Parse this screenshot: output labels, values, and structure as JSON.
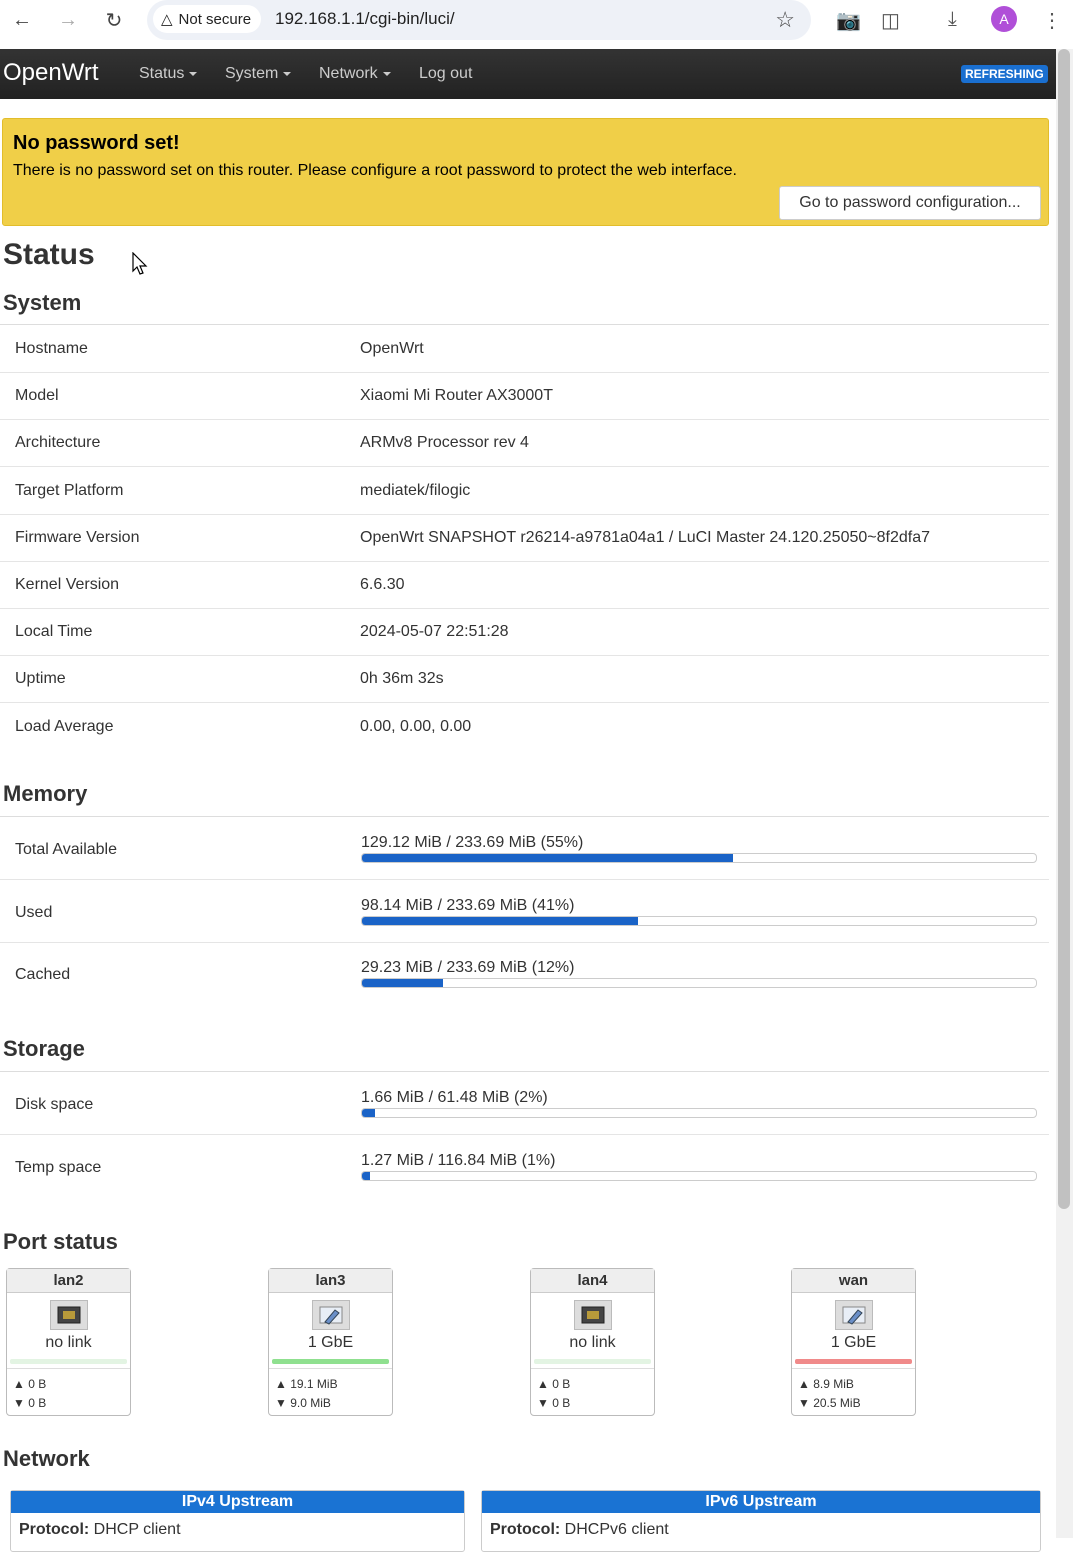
{
  "browser": {
    "security_label": "Not secure",
    "url": "192.168.1.1/cgi-bin/luci/",
    "avatar_letter": "A"
  },
  "header": {
    "brand": "OpenWrt",
    "menus": [
      "Status",
      "System",
      "Network"
    ],
    "logout": "Log out",
    "badge": "REFRESHING"
  },
  "alert": {
    "title": "No password set!",
    "message": "There is no password set on this router. Please configure a root password to protect the web interface.",
    "button": "Go to password configuration..."
  },
  "page_title": "Status",
  "system": {
    "title": "System",
    "rows": [
      {
        "key": "Hostname",
        "value": "OpenWrt"
      },
      {
        "key": "Model",
        "value": "Xiaomi Mi Router AX3000T"
      },
      {
        "key": "Architecture",
        "value": "ARMv8 Processor rev 4"
      },
      {
        "key": "Target Platform",
        "value": "mediatek/filogic"
      },
      {
        "key": "Firmware Version",
        "value": "OpenWrt SNAPSHOT r26214-a9781a04a1 / LuCI Master 24.120.25050~8f2dfa7"
      },
      {
        "key": "Kernel Version",
        "value": "6.6.30"
      },
      {
        "key": "Local Time",
        "value": "2024-05-07 22:51:28"
      },
      {
        "key": "Uptime",
        "value": "0h 36m 32s"
      },
      {
        "key": "Load Average",
        "value": "0.00, 0.00, 0.00"
      }
    ]
  },
  "memory": {
    "title": "Memory",
    "rows": [
      {
        "key": "Total Available",
        "text": "129.12 MiB / 233.69 MiB (55%)",
        "percent": 55
      },
      {
        "key": "Used",
        "text": "98.14 MiB / 233.69 MiB (41%)",
        "percent": 41
      },
      {
        "key": "Cached",
        "text": "29.23 MiB / 233.69 MiB (12%)",
        "percent": 12
      }
    ]
  },
  "storage": {
    "title": "Storage",
    "rows": [
      {
        "key": "Disk space",
        "text": "1.66 MiB / 61.48 MiB (2%)",
        "percent": 2
      },
      {
        "key": "Temp space",
        "text": "1.27 MiB / 116.84 MiB (1%)",
        "percent": 1
      }
    ]
  },
  "ports": {
    "title": "Port status",
    "items": [
      {
        "name": "lan2",
        "speed": "no link",
        "up": "▲ 0 B",
        "down": "▼ 0 B",
        "link_color": "#e3f4e3",
        "icon_state": "down"
      },
      {
        "name": "lan3",
        "speed": "1 GbE",
        "up": "▲ 19.1 MiB",
        "down": "▼ 9.0 MiB",
        "link_color": "#8fe08f",
        "icon_state": "up"
      },
      {
        "name": "lan4",
        "speed": "no link",
        "up": "▲ 0 B",
        "down": "▼ 0 B",
        "link_color": "#e3f4e3",
        "icon_state": "down"
      },
      {
        "name": "wan",
        "speed": "1 GbE",
        "up": "▲ 8.9 MiB",
        "down": "▼ 20.5 MiB",
        "link_color": "#f08a8a",
        "icon_state": "up"
      }
    ]
  },
  "network": {
    "title": "Network",
    "boxes": [
      {
        "title": "IPv4 Upstream",
        "protocol_label": "Protocol:",
        "protocol": "DHCP client"
      },
      {
        "title": "IPv6 Upstream",
        "protocol_label": "Protocol:",
        "protocol": "DHCPv6 client"
      }
    ]
  }
}
